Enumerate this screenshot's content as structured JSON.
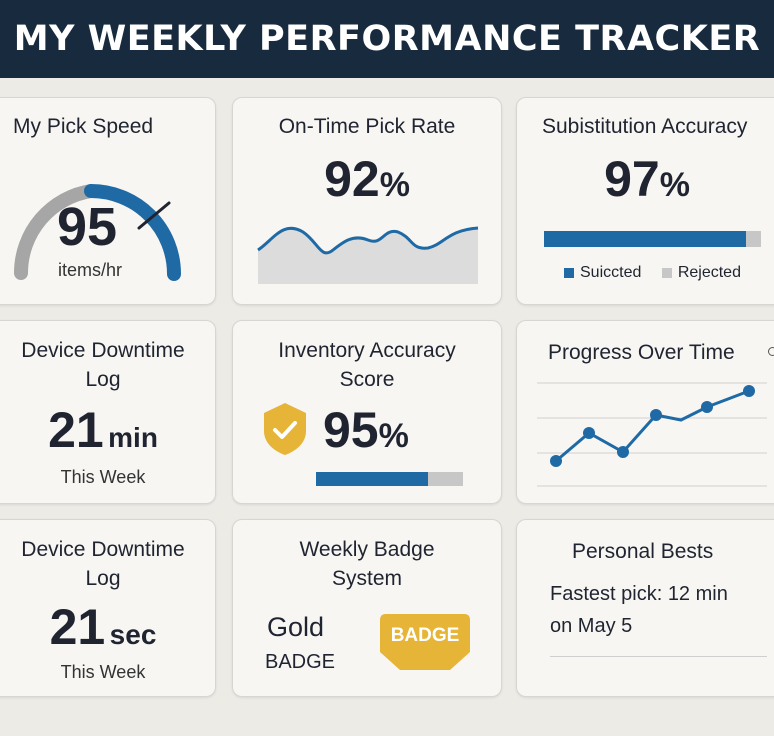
{
  "header": {
    "title": "MY WEEKLY PERFORMANCE TRACKER"
  },
  "colors": {
    "header_bg": "#182a3d",
    "accent_blue": "#1f6aa5",
    "gauge_gray": "#a6a6a6",
    "badge_gold": "#e6b437",
    "card_bg": "#f7f6f3"
  },
  "pick_speed": {
    "title": "My Pick Speed",
    "value": "95",
    "unit": "items/hr"
  },
  "on_time": {
    "title": "On-Time Pick Rate",
    "value": "92",
    "unit": "%"
  },
  "substitution": {
    "title": "Subistitution Accuracy",
    "value": "97",
    "unit": "%",
    "bar_fraction": 0.93,
    "legend": [
      {
        "label": "Suiccted",
        "color": "#1f6aa5"
      },
      {
        "label": "Rejected",
        "color": "#c7c7c7"
      }
    ]
  },
  "downtime_min": {
    "title_line1": "Device Downtime",
    "title_line2": "Log",
    "value": "21",
    "unit": "min",
    "caption": "This Week"
  },
  "inventory": {
    "title_line1": "Inventory Accuracy",
    "title_line2": "Score",
    "value": "95",
    "unit": "%",
    "bar_fraction": 0.76,
    "icon": "shield-check-icon"
  },
  "progress": {
    "title": "Progress Over Time"
  },
  "downtime_sec": {
    "title_line1": "Device Downtime",
    "title_line2": "Log",
    "value": "21",
    "unit": "sec",
    "caption": "This Week"
  },
  "badge": {
    "title_line1": "Weekly Badge",
    "title_line2": "System",
    "level": "Gold",
    "level_caption": "BADGE",
    "badge_label": "BADGE"
  },
  "bests": {
    "title": "Personal Bests",
    "line1": "Fastest pick: 12 min",
    "line2": "on May 5"
  }
}
